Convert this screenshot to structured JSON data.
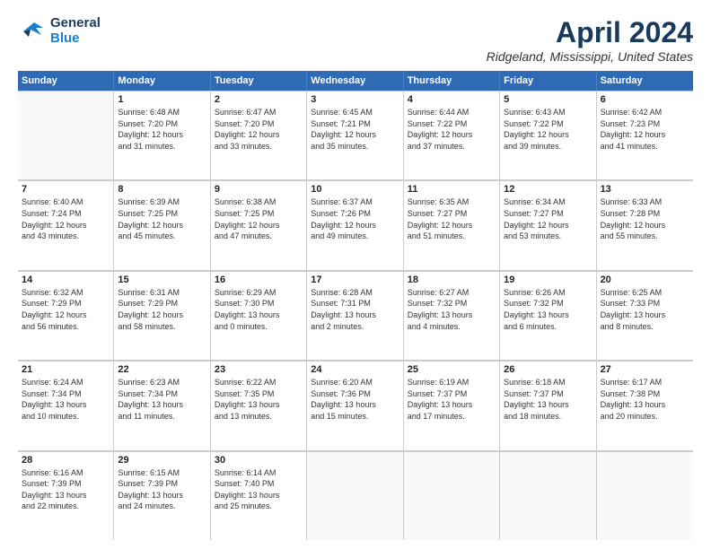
{
  "logo": {
    "line1": "General",
    "line2": "Blue"
  },
  "title": "April 2024",
  "location": "Ridgeland, Mississippi, United States",
  "weekdays": [
    "Sunday",
    "Monday",
    "Tuesday",
    "Wednesday",
    "Thursday",
    "Friday",
    "Saturday"
  ],
  "weeks": [
    [
      {
        "day": "",
        "lines": []
      },
      {
        "day": "1",
        "lines": [
          "Sunrise: 6:48 AM",
          "Sunset: 7:20 PM",
          "Daylight: 12 hours",
          "and 31 minutes."
        ]
      },
      {
        "day": "2",
        "lines": [
          "Sunrise: 6:47 AM",
          "Sunset: 7:20 PM",
          "Daylight: 12 hours",
          "and 33 minutes."
        ]
      },
      {
        "day": "3",
        "lines": [
          "Sunrise: 6:45 AM",
          "Sunset: 7:21 PM",
          "Daylight: 12 hours",
          "and 35 minutes."
        ]
      },
      {
        "day": "4",
        "lines": [
          "Sunrise: 6:44 AM",
          "Sunset: 7:22 PM",
          "Daylight: 12 hours",
          "and 37 minutes."
        ]
      },
      {
        "day": "5",
        "lines": [
          "Sunrise: 6:43 AM",
          "Sunset: 7:22 PM",
          "Daylight: 12 hours",
          "and 39 minutes."
        ]
      },
      {
        "day": "6",
        "lines": [
          "Sunrise: 6:42 AM",
          "Sunset: 7:23 PM",
          "Daylight: 12 hours",
          "and 41 minutes."
        ]
      }
    ],
    [
      {
        "day": "7",
        "lines": [
          "Sunrise: 6:40 AM",
          "Sunset: 7:24 PM",
          "Daylight: 12 hours",
          "and 43 minutes."
        ]
      },
      {
        "day": "8",
        "lines": [
          "Sunrise: 6:39 AM",
          "Sunset: 7:25 PM",
          "Daylight: 12 hours",
          "and 45 minutes."
        ]
      },
      {
        "day": "9",
        "lines": [
          "Sunrise: 6:38 AM",
          "Sunset: 7:25 PM",
          "Daylight: 12 hours",
          "and 47 minutes."
        ]
      },
      {
        "day": "10",
        "lines": [
          "Sunrise: 6:37 AM",
          "Sunset: 7:26 PM",
          "Daylight: 12 hours",
          "and 49 minutes."
        ]
      },
      {
        "day": "11",
        "lines": [
          "Sunrise: 6:35 AM",
          "Sunset: 7:27 PM",
          "Daylight: 12 hours",
          "and 51 minutes."
        ]
      },
      {
        "day": "12",
        "lines": [
          "Sunrise: 6:34 AM",
          "Sunset: 7:27 PM",
          "Daylight: 12 hours",
          "and 53 minutes."
        ]
      },
      {
        "day": "13",
        "lines": [
          "Sunrise: 6:33 AM",
          "Sunset: 7:28 PM",
          "Daylight: 12 hours",
          "and 55 minutes."
        ]
      }
    ],
    [
      {
        "day": "14",
        "lines": [
          "Sunrise: 6:32 AM",
          "Sunset: 7:29 PM",
          "Daylight: 12 hours",
          "and 56 minutes."
        ]
      },
      {
        "day": "15",
        "lines": [
          "Sunrise: 6:31 AM",
          "Sunset: 7:29 PM",
          "Daylight: 12 hours",
          "and 58 minutes."
        ]
      },
      {
        "day": "16",
        "lines": [
          "Sunrise: 6:29 AM",
          "Sunset: 7:30 PM",
          "Daylight: 13 hours",
          "and 0 minutes."
        ]
      },
      {
        "day": "17",
        "lines": [
          "Sunrise: 6:28 AM",
          "Sunset: 7:31 PM",
          "Daylight: 13 hours",
          "and 2 minutes."
        ]
      },
      {
        "day": "18",
        "lines": [
          "Sunrise: 6:27 AM",
          "Sunset: 7:32 PM",
          "Daylight: 13 hours",
          "and 4 minutes."
        ]
      },
      {
        "day": "19",
        "lines": [
          "Sunrise: 6:26 AM",
          "Sunset: 7:32 PM",
          "Daylight: 13 hours",
          "and 6 minutes."
        ]
      },
      {
        "day": "20",
        "lines": [
          "Sunrise: 6:25 AM",
          "Sunset: 7:33 PM",
          "Daylight: 13 hours",
          "and 8 minutes."
        ]
      }
    ],
    [
      {
        "day": "21",
        "lines": [
          "Sunrise: 6:24 AM",
          "Sunset: 7:34 PM",
          "Daylight: 13 hours",
          "and 10 minutes."
        ]
      },
      {
        "day": "22",
        "lines": [
          "Sunrise: 6:23 AM",
          "Sunset: 7:34 PM",
          "Daylight: 13 hours",
          "and 11 minutes."
        ]
      },
      {
        "day": "23",
        "lines": [
          "Sunrise: 6:22 AM",
          "Sunset: 7:35 PM",
          "Daylight: 13 hours",
          "and 13 minutes."
        ]
      },
      {
        "day": "24",
        "lines": [
          "Sunrise: 6:20 AM",
          "Sunset: 7:36 PM",
          "Daylight: 13 hours",
          "and 15 minutes."
        ]
      },
      {
        "day": "25",
        "lines": [
          "Sunrise: 6:19 AM",
          "Sunset: 7:37 PM",
          "Daylight: 13 hours",
          "and 17 minutes."
        ]
      },
      {
        "day": "26",
        "lines": [
          "Sunrise: 6:18 AM",
          "Sunset: 7:37 PM",
          "Daylight: 13 hours",
          "and 18 minutes."
        ]
      },
      {
        "day": "27",
        "lines": [
          "Sunrise: 6:17 AM",
          "Sunset: 7:38 PM",
          "Daylight: 13 hours",
          "and 20 minutes."
        ]
      }
    ],
    [
      {
        "day": "28",
        "lines": [
          "Sunrise: 6:16 AM",
          "Sunset: 7:39 PM",
          "Daylight: 13 hours",
          "and 22 minutes."
        ]
      },
      {
        "day": "29",
        "lines": [
          "Sunrise: 6:15 AM",
          "Sunset: 7:39 PM",
          "Daylight: 13 hours",
          "and 24 minutes."
        ]
      },
      {
        "day": "30",
        "lines": [
          "Sunrise: 6:14 AM",
          "Sunset: 7:40 PM",
          "Daylight: 13 hours",
          "and 25 minutes."
        ]
      },
      {
        "day": "",
        "lines": []
      },
      {
        "day": "",
        "lines": []
      },
      {
        "day": "",
        "lines": []
      },
      {
        "day": "",
        "lines": []
      }
    ]
  ]
}
